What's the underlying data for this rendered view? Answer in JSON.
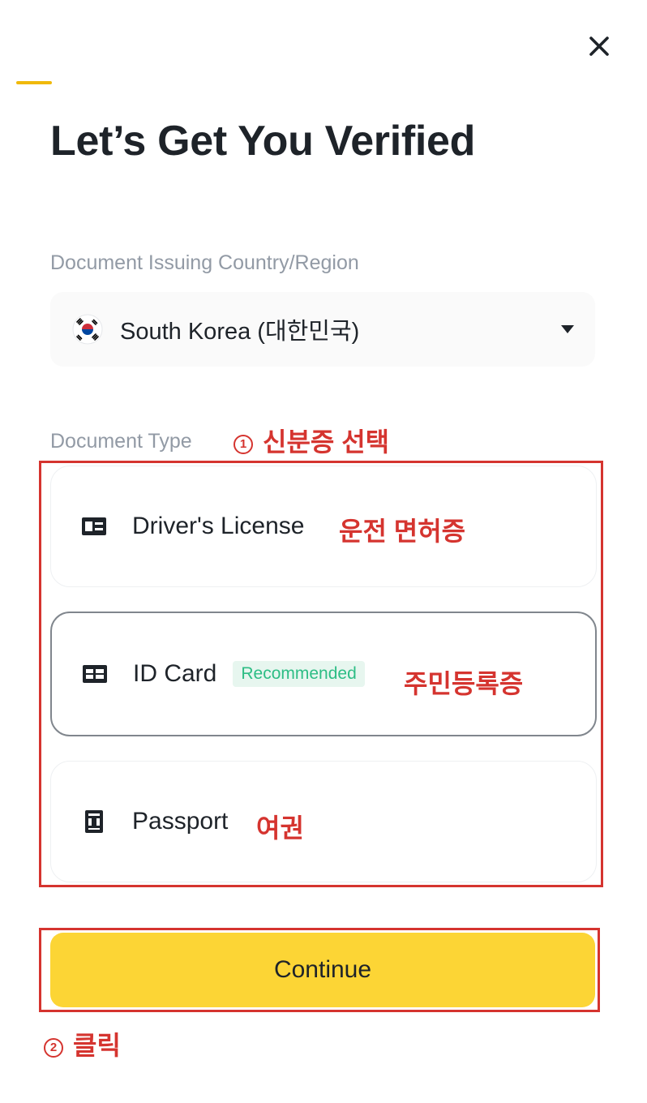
{
  "modal": {
    "title": "Let’s Get You Verified",
    "close_icon": "close-icon",
    "accent_color": "#F0B90B"
  },
  "country": {
    "label": "Document Issuing Country/Region",
    "selected": "South Korea (대한민국)",
    "flag_icon": "south-korea-flag-icon"
  },
  "document_type": {
    "label": "Document Type",
    "options": [
      {
        "label": "Driver's License",
        "icon": "license-card-icon",
        "selected": false
      },
      {
        "label": "ID Card",
        "icon": "id-card-icon",
        "badge": "Recommended",
        "selected": true
      },
      {
        "label": "Passport",
        "icon": "passport-icon",
        "selected": false
      }
    ]
  },
  "continue_button": {
    "label": "Continue",
    "color": "#FCD535"
  },
  "annotations": {
    "step1_number": "1",
    "step1_text": "신분증 선택",
    "drivers_license": "운전 면허증",
    "id_card": "주민등록증",
    "passport": "여권",
    "step2_number": "2",
    "step2_text": "클릭",
    "color": "#D5342F"
  }
}
